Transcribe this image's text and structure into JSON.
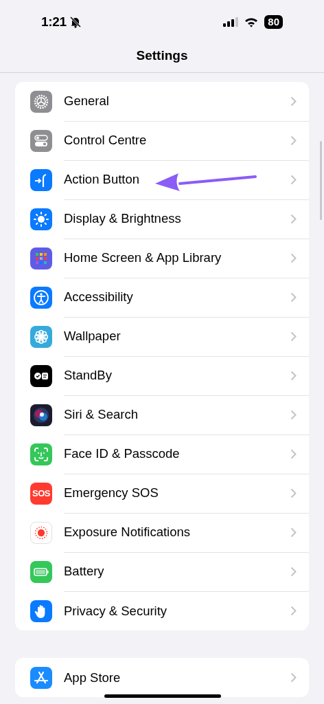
{
  "status_bar": {
    "time": "1:21",
    "silent": true,
    "battery": "80"
  },
  "nav": {
    "title": "Settings"
  },
  "groups": [
    {
      "items": [
        {
          "label": "General",
          "kind": "gear"
        },
        {
          "label": "Control Centre",
          "kind": "toggles"
        },
        {
          "label": "Action Button",
          "kind": "action"
        },
        {
          "label": "Display & Brightness",
          "kind": "sun"
        },
        {
          "label": "Home Screen & App Library",
          "kind": "grid"
        },
        {
          "label": "Accessibility",
          "kind": "person"
        },
        {
          "label": "Wallpaper",
          "kind": "flower"
        },
        {
          "label": "StandBy",
          "kind": "standby"
        },
        {
          "label": "Siri & Search",
          "kind": "siri"
        },
        {
          "label": "Face ID & Passcode",
          "kind": "face"
        },
        {
          "label": "Emergency SOS",
          "kind": "sos",
          "icon_text": "SOS"
        },
        {
          "label": "Exposure Notifications",
          "kind": "exposure"
        },
        {
          "label": "Battery",
          "kind": "battery"
        },
        {
          "label": "Privacy & Security",
          "kind": "hand"
        }
      ]
    },
    {
      "items": [
        {
          "label": "App Store",
          "kind": "appstore"
        }
      ]
    }
  ]
}
